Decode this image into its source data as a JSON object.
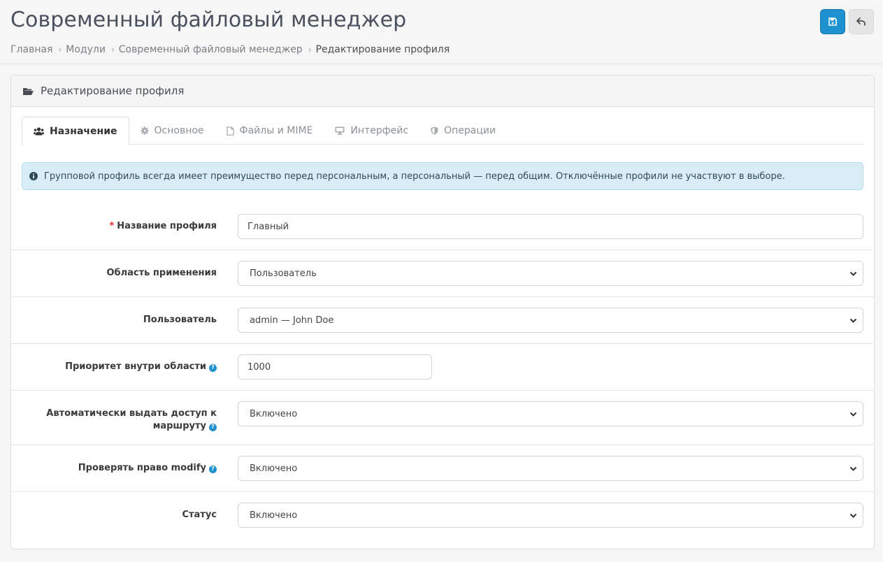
{
  "header": {
    "title": "Современный файловый менеджер",
    "breadcrumb": [
      "Главная",
      "Модули",
      "Современный файловый менеджер",
      "Редактирование профиля"
    ]
  },
  "card": {
    "title": "Редактирование профиля",
    "tabs": [
      {
        "label": "Назначение",
        "icon": "users-icon",
        "active": true
      },
      {
        "label": "Основное",
        "icon": "cog-icon"
      },
      {
        "label": "Файлы и MIME",
        "icon": "file-icon"
      },
      {
        "label": "Интерфейс",
        "icon": "desktop-icon"
      },
      {
        "label": "Операции",
        "icon": "shield-icon"
      }
    ],
    "alert": "Групповой профиль всегда имеет преимущество перед персональным, а персональный — перед общим. Отключённые профили не участвуют в выборе."
  },
  "form": {
    "name": {
      "label": "Название профиля",
      "required": "*",
      "value": "Главный"
    },
    "scope": {
      "label": "Область применения",
      "value": "Пользователь"
    },
    "user": {
      "label": "Пользователь",
      "value": "admin — John Doe"
    },
    "priority": {
      "label": "Приоритет внутри области",
      "value": "1000"
    },
    "auto_access": {
      "label_line1": "Автоматически выдать доступ к",
      "label_line2": "маршруту",
      "value": "Включено"
    },
    "check_modify": {
      "label": "Проверять право modify",
      "value": "Включено"
    },
    "status": {
      "label": "Статус",
      "value": "Включено"
    }
  },
  "colors": {
    "primary": "#1e91cf",
    "alert_bg": "#d8edf6",
    "required": "#e3262e"
  }
}
